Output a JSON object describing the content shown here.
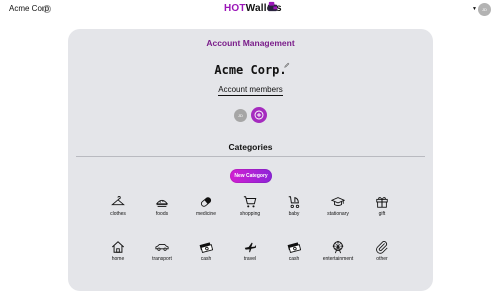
{
  "header": {
    "org_name": "Acme Corp.",
    "org_info_icon": "info-icon",
    "brand_hot": "HOT",
    "brand_wallets": "Wallets",
    "brand_icon": "wallet-icon",
    "user_initials": "JD",
    "user_menu_icon": "caret-down-icon"
  },
  "main": {
    "title": "Account Management",
    "company_name": "Acme Corp.",
    "edit_icon": "pencil-icon",
    "members_link": "Account members",
    "member_initials": "JD",
    "add_member_icon": "plus-circle-icon",
    "categories_title": "Categories",
    "new_category_label": "New Category"
  },
  "categories": [
    {
      "label": "clothes",
      "icon": "hanger-icon"
    },
    {
      "label": "foods",
      "icon": "food-icon"
    },
    {
      "label": "medicine",
      "icon": "pill-icon"
    },
    {
      "label": "shopping",
      "icon": "cart-icon"
    },
    {
      "label": "baby",
      "icon": "stroller-icon"
    },
    {
      "label": "stationary",
      "icon": "graduation-cap-icon"
    },
    {
      "label": "gift",
      "icon": "gift-icon"
    },
    {
      "label": "home",
      "icon": "home-icon"
    },
    {
      "label": "transport",
      "icon": "car-icon"
    },
    {
      "label": "cash",
      "icon": "cash-icon"
    },
    {
      "label": "travel",
      "icon": "plane-icon"
    },
    {
      "label": "cash",
      "icon": "cash-icon"
    },
    {
      "label": "entertainment",
      "icon": "ferris-wheel-icon"
    },
    {
      "label": "other",
      "icon": "paperclip-icon"
    }
  ],
  "colors": {
    "accent": "#9b16b8",
    "button_gradient_start": "#d21fd2",
    "button_gradient_end": "#8d24d8",
    "card_bg": "#e4e5e9"
  }
}
